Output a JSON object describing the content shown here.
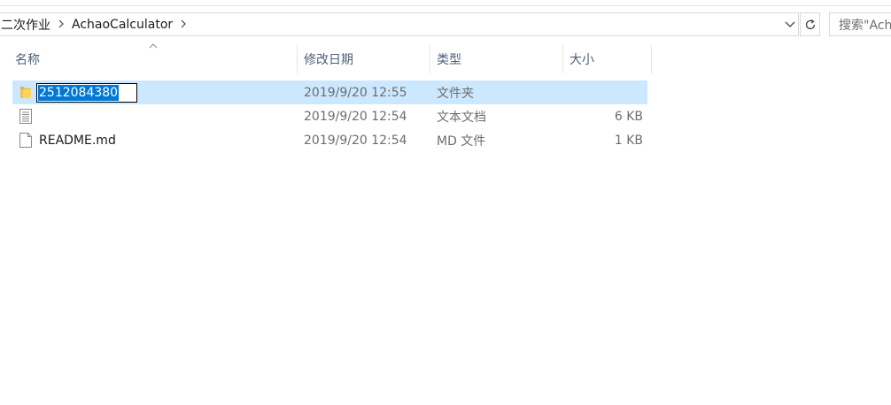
{
  "address_bar": {
    "crumbs": [
      {
        "label": "二次作业"
      },
      {
        "label": "AchaoCalculator"
      }
    ]
  },
  "search": {
    "placeholder": "搜索\"AchaoCalculator\""
  },
  "columns": {
    "name": "名称",
    "date": "修改日期",
    "type": "类型",
    "size": "大小"
  },
  "files": [
    {
      "name": "2512084380",
      "date": "2019/9/20 12:55",
      "type": "文件夹",
      "size": "",
      "icon": "folder-icon",
      "selected": true,
      "renaming": true
    },
    {
      "name": "",
      "date": "2019/9/20 12:54",
      "type": "文本文档",
      "size": "6 KB",
      "icon": "text-document-icon",
      "selected": false,
      "renaming": false
    },
    {
      "name": "README.md",
      "date": "2019/9/20 12:54",
      "type": "MD 文件",
      "size": "1 KB",
      "icon": "blank-file-icon",
      "selected": false,
      "renaming": false
    }
  ],
  "colors": {
    "selection": "#cce8ff",
    "rename_highlight": "#0078d7",
    "header_text": "#4c607a",
    "secondary_text": "#6d6d6d"
  }
}
